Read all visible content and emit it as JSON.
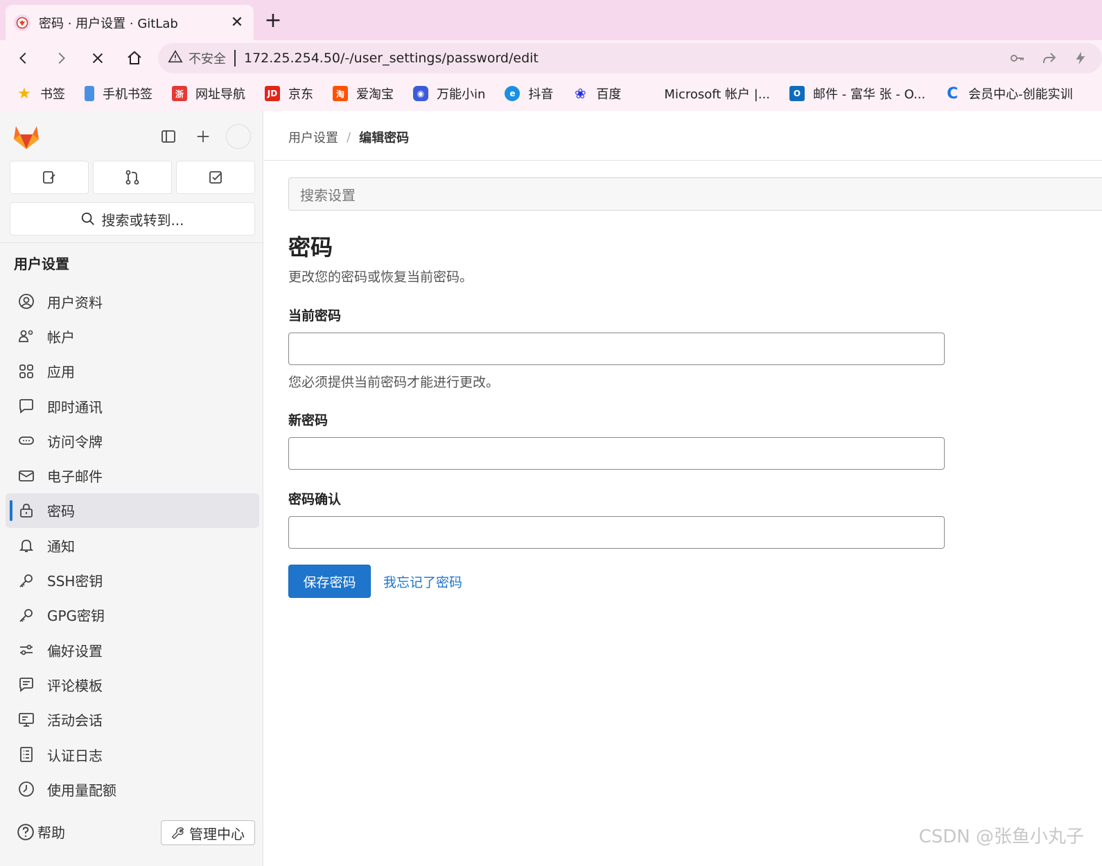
{
  "browser": {
    "tab_title": "密码 · 用户设置 · GitLab",
    "security_label": "不安全",
    "url": "172.25.254.50/-/user_settings/password/edit",
    "bookmarks": [
      {
        "label": "书签",
        "icon": "star-icon",
        "color": "#f6b400"
      },
      {
        "label": "手机书签",
        "icon": "phone-icon",
        "color": "#4a90e2"
      },
      {
        "label": "网址导航",
        "icon": "nav-icon",
        "color": "#e53935"
      },
      {
        "label": "京东",
        "icon": "jd-icon",
        "color": "#e1251b"
      },
      {
        "label": "爱淘宝",
        "icon": "taobao-icon",
        "color": "#ff5000"
      },
      {
        "label": "万能小in",
        "icon": "robot-icon",
        "color": "#3b5bdb"
      },
      {
        "label": "抖音",
        "icon": "edge-icon",
        "color": "#1a8fe3"
      },
      {
        "label": "百度",
        "icon": "baidu-icon",
        "color": "#2932e1"
      },
      {
        "label": "Microsoft 帐户 |...",
        "icon": "microsoft-icon",
        "color": "#f25022"
      },
      {
        "label": "邮件 - 富华 张 - O...",
        "icon": "outlook-icon",
        "color": "#0f6cbd"
      },
      {
        "label": "会员中心-创能实训",
        "icon": "c-icon",
        "color": "#1a73e8"
      }
    ]
  },
  "sidebar": {
    "search_label": "搜索或转到...",
    "section_title": "用户设置",
    "items": [
      {
        "label": "用户资料",
        "icon": "profile-icon"
      },
      {
        "label": "帐户",
        "icon": "account-icon"
      },
      {
        "label": "应用",
        "icon": "applications-icon"
      },
      {
        "label": "即时通讯",
        "icon": "chat-icon"
      },
      {
        "label": "访问令牌",
        "icon": "token-icon"
      },
      {
        "label": "电子邮件",
        "icon": "mail-icon"
      },
      {
        "label": "密码",
        "icon": "lock-icon"
      },
      {
        "label": "通知",
        "icon": "bell-icon"
      },
      {
        "label": "SSH密钥",
        "icon": "key-icon"
      },
      {
        "label": "GPG密钥",
        "icon": "key-icon"
      },
      {
        "label": "偏好设置",
        "icon": "preferences-icon"
      },
      {
        "label": "评论模板",
        "icon": "comment-template-icon"
      },
      {
        "label": "活动会话",
        "icon": "monitor-icon"
      },
      {
        "label": "认证日志",
        "icon": "log-icon"
      },
      {
        "label": "使用量配额",
        "icon": "quota-icon"
      }
    ],
    "active_index": 6,
    "help_label": "帮助",
    "admin_label": "管理中心"
  },
  "main": {
    "breadcrumb": [
      "用户设置",
      "编辑密码"
    ],
    "settings_search_placeholder": "搜索设置",
    "title": "密码",
    "description": "更改您的密码或恢复当前密码。",
    "current_password_label": "当前密码",
    "current_password_help": "您必须提供当前密码才能进行更改。",
    "new_password_label": "新密码",
    "confirm_password_label": "密码确认",
    "save_button": "保存密码",
    "forgot_link": "我忘记了密码"
  },
  "watermark": "CSDN @张鱼小丸子",
  "colors": {
    "accent": "#1f75cb",
    "gitlab_orange": "#e24329",
    "tabbar": "#f6d9ec"
  }
}
